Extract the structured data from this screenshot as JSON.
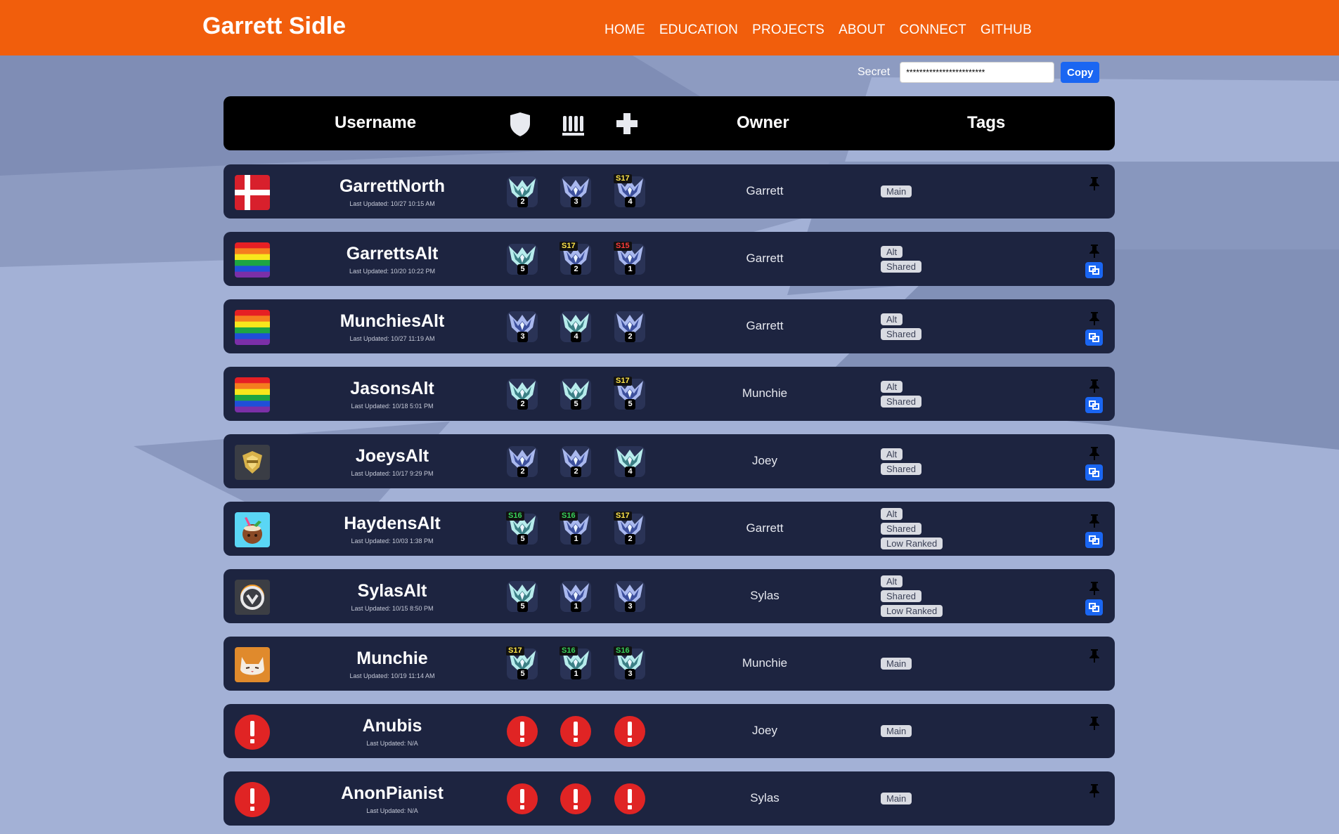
{
  "header": {
    "brand": "Garrett Sidle",
    "nav": [
      "HOME",
      "EDUCATION",
      "PROJECTS",
      "ABOUT",
      "CONNECT",
      "GITHUB"
    ]
  },
  "secret": {
    "label": "Secret",
    "value": "************************",
    "copy_label": "Copy"
  },
  "table": {
    "columns": {
      "username": "Username",
      "tank_icon": "shield-icon",
      "damage_icon": "bullets-icon",
      "support_icon": "cross-icon",
      "owner": "Owner",
      "tags": "Tags"
    },
    "rows": [
      {
        "username": "GarrettNorth",
        "updated": "Last Updated: 10/27 10:15 AM",
        "avatar": "denmark-flag",
        "ranks": [
          {
            "tier": "plat",
            "division": "2",
            "season": ""
          },
          {
            "tier": "diamond",
            "division": "3",
            "season": ""
          },
          {
            "tier": "diamond",
            "division": "4",
            "season": "S17"
          }
        ],
        "owner": "Garrett",
        "tags": [
          "Main"
        ],
        "link": false
      },
      {
        "username": "GarrettsAlt",
        "updated": "Last Updated: 10/20 10:22 PM",
        "avatar": "rainbow-flag",
        "ranks": [
          {
            "tier": "plat",
            "division": "5",
            "season": ""
          },
          {
            "tier": "diamond",
            "division": "2",
            "season": "S17"
          },
          {
            "tier": "diamond",
            "division": "1",
            "season": "S15"
          }
        ],
        "owner": "Garrett",
        "tags": [
          "Alt",
          "Shared"
        ],
        "link": true
      },
      {
        "username": "MunchiesAlt",
        "updated": "Last Updated: 10/27 11:19 AM",
        "avatar": "rainbow-flag",
        "ranks": [
          {
            "tier": "diamond",
            "division": "3",
            "season": ""
          },
          {
            "tier": "plat",
            "division": "4",
            "season": ""
          },
          {
            "tier": "diamond",
            "division": "2",
            "season": ""
          }
        ],
        "owner": "Garrett",
        "tags": [
          "Alt",
          "Shared"
        ],
        "link": true
      },
      {
        "username": "JasonsAlt",
        "updated": "Last Updated: 10/18 5:01 PM",
        "avatar": "rainbow-flag",
        "ranks": [
          {
            "tier": "plat",
            "division": "2",
            "season": ""
          },
          {
            "tier": "plat",
            "division": "5",
            "season": ""
          },
          {
            "tier": "diamond",
            "division": "5",
            "season": "S17"
          }
        ],
        "owner": "Munchie",
        "tags": [
          "Alt",
          "Shared"
        ],
        "link": true
      },
      {
        "username": "JoeysAlt",
        "updated": "Last Updated: 10/17 9:29 PM",
        "avatar": "gold-emblem",
        "ranks": [
          {
            "tier": "diamond",
            "division": "2",
            "season": ""
          },
          {
            "tier": "diamond",
            "division": "2",
            "season": ""
          },
          {
            "tier": "plat",
            "division": "4",
            "season": ""
          }
        ],
        "owner": "Joey",
        "tags": [
          "Alt",
          "Shared"
        ],
        "link": true
      },
      {
        "username": "HaydensAlt",
        "updated": "Last Updated: 10/03 1:38 PM",
        "avatar": "coconut",
        "ranks": [
          {
            "tier": "plat",
            "division": "5",
            "season": "S16"
          },
          {
            "tier": "diamond",
            "division": "1",
            "season": "S16"
          },
          {
            "tier": "diamond",
            "division": "2",
            "season": "S17"
          }
        ],
        "owner": "Garrett",
        "tags": [
          "Alt",
          "Shared",
          "Low Ranked"
        ],
        "link": true
      },
      {
        "username": "SylasAlt",
        "updated": "Last Updated: 10/15 8:50 PM",
        "avatar": "overwatch-logo",
        "ranks": [
          {
            "tier": "plat",
            "division": "5",
            "season": ""
          },
          {
            "tier": "diamond",
            "division": "1",
            "season": ""
          },
          {
            "tier": "diamond",
            "division": "3",
            "season": ""
          }
        ],
        "owner": "Sylas",
        "tags": [
          "Alt",
          "Shared",
          "Low Ranked"
        ],
        "link": true
      },
      {
        "username": "Munchie",
        "updated": "Last Updated: 10/19 11:14 AM",
        "avatar": "cat",
        "ranks": [
          {
            "tier": "plat",
            "division": "5",
            "season": "S17"
          },
          {
            "tier": "plat",
            "division": "1",
            "season": "S16"
          },
          {
            "tier": "plat",
            "division": "3",
            "season": "S16"
          }
        ],
        "owner": "Munchie",
        "tags": [
          "Main"
        ],
        "link": false
      },
      {
        "username": "Anubis",
        "updated": "Last Updated: N/A",
        "avatar": "error",
        "ranks": [
          {
            "tier": "error",
            "division": "",
            "season": ""
          },
          {
            "tier": "error",
            "division": "",
            "season": ""
          },
          {
            "tier": "error",
            "division": "",
            "season": ""
          }
        ],
        "owner": "Joey",
        "tags": [
          "Main"
        ],
        "link": false
      },
      {
        "username": "AnonPianist",
        "updated": "Last Updated: N/A",
        "avatar": "error",
        "ranks": [
          {
            "tier": "error",
            "division": "",
            "season": ""
          },
          {
            "tier": "error",
            "division": "",
            "season": ""
          },
          {
            "tier": "error",
            "division": "",
            "season": ""
          }
        ],
        "owner": "Sylas",
        "tags": [
          "Main"
        ],
        "link": false
      }
    ]
  },
  "colors": {
    "header_bg": "#f15e0c",
    "page_bg": "#a3b1d6",
    "row_bg": "#1d2440",
    "accent": "#1a66f2",
    "error": "#e02424"
  }
}
